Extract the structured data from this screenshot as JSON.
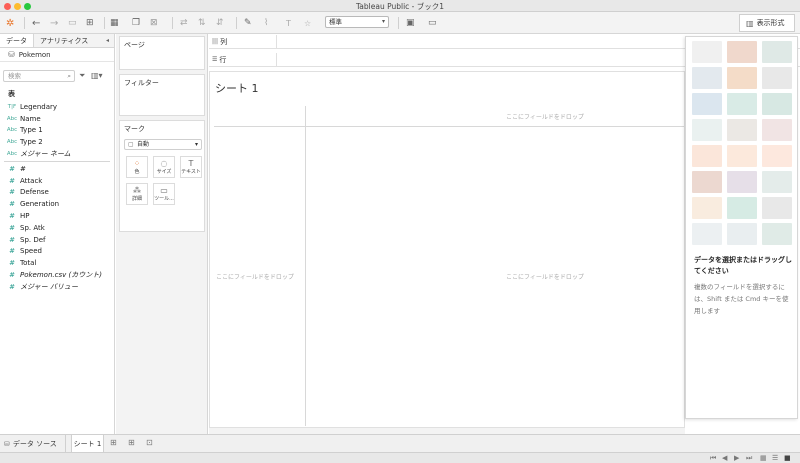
{
  "window": {
    "title": "Tableau Public - ブック1"
  },
  "toolbar": {
    "standard_select": "標準",
    "show_me_label": "表示形式",
    "icons": [
      "tableau-logo-icon",
      "undo-icon",
      "redo-icon",
      "save-icon",
      "new-datasource-icon",
      "new-sheet-icon",
      "duplicate-icon",
      "clear-icon",
      "swap-icon",
      "sort-asc-icon",
      "sort-desc-icon",
      "highlight-icon",
      "group-icon",
      "label-icon",
      "pin-icon",
      "fit-icon",
      "presentation-icon"
    ]
  },
  "data_pane": {
    "tabs": [
      "データ",
      "アナリティクス"
    ],
    "datasource": "Pokemon",
    "search_placeholder": "検索",
    "table_heading": "表",
    "dimensions": [
      {
        "type": "T|F",
        "name": "Legendary"
      },
      {
        "type": "Abc",
        "name": "Name"
      },
      {
        "type": "Abc",
        "name": "Type 1"
      },
      {
        "type": "Abc",
        "name": "Type 2"
      },
      {
        "type": "Abc",
        "name": "メジャー ネーム"
      }
    ],
    "measures": [
      {
        "type": "#",
        "name": "#"
      },
      {
        "type": "#",
        "name": "Attack"
      },
      {
        "type": "#",
        "name": "Defense"
      },
      {
        "type": "#",
        "name": "Generation"
      },
      {
        "type": "#",
        "name": "HP"
      },
      {
        "type": "#",
        "name": "Sp. Atk"
      },
      {
        "type": "#",
        "name": "Sp. Def"
      },
      {
        "type": "#",
        "name": "Speed"
      },
      {
        "type": "#",
        "name": "Total"
      },
      {
        "type": "#",
        "name": "Pokemon.csv (カウント)"
      },
      {
        "type": "#",
        "name": "メジャー バリュー"
      }
    ]
  },
  "cards": {
    "pages": "ページ",
    "filters": "フィルター",
    "marks": "マーク",
    "marks_type": "自動",
    "mark_buttons": {
      "color": "色",
      "size": "サイズ",
      "text": "テキスト",
      "detail": "詳細",
      "tooltip": "ツール..."
    }
  },
  "shelves": {
    "columns": "列",
    "rows": "行"
  },
  "view": {
    "sheet_title": "シート 1",
    "drop_hint": "ここにフィールドをドロップ"
  },
  "show_me": {
    "heading": "データを選択またはドラッグしてください",
    "help": "複数のフィールドを選択するには、Shift または Cmd キーを使用します",
    "thumbs": [
      {
        "color": "#f0f0f0"
      },
      {
        "color": "#f0d8cc"
      },
      {
        "color": "#dfe9e6"
      },
      {
        "color": "#e3e9ee"
      },
      {
        "color": "#f4dcc8"
      },
      {
        "color": "#e8e8e8"
      },
      {
        "color": "#dbe6ef"
      },
      {
        "color": "#d9ebe6"
      },
      {
        "color": "#d7e8e3"
      },
      {
        "color": "#eaf1f0"
      },
      {
        "color": "#ebe8e4"
      },
      {
        "color": "#f1e4e4"
      },
      {
        "color": "#fbe6da"
      },
      {
        "color": "#fce9dc"
      },
      {
        "color": "#fde8de"
      },
      {
        "color": "#ecd8d0"
      },
      {
        "color": "#e6dfe8"
      },
      {
        "color": "#e4ecea"
      },
      {
        "color": "#f9ecdf"
      },
      {
        "color": "#d6ebe4"
      },
      {
        "color": "#e8e8e8"
      },
      {
        "color": "#ecf0f2"
      },
      {
        "color": "#e9eef0"
      },
      {
        "color": "#e0ebe7"
      }
    ]
  },
  "bottom": {
    "datasource_tab": "データ ソース",
    "sheet_tab": "シート 1"
  }
}
